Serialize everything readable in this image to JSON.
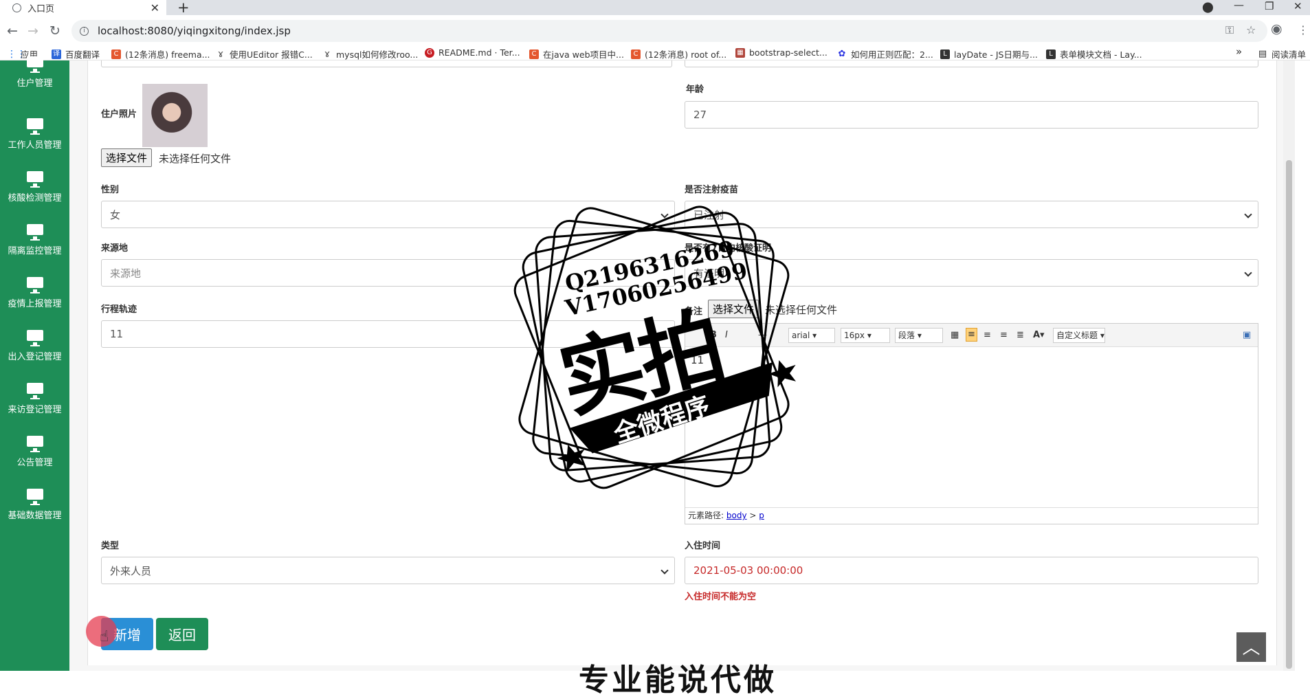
{
  "browser": {
    "tab_title": "入口页",
    "url": "localhost:8080/yiqingxitong/index.jsp",
    "bookmarks": [
      {
        "label": "应用",
        "color": "#1a73e8",
        "glyph": "⋮"
      },
      {
        "label": "百度翻译",
        "color": "#2b65d9",
        "glyph": "译"
      },
      {
        "label": "(12条消息) freema...",
        "color": "#e4572e",
        "glyph": "C"
      },
      {
        "label": "使用UEditor 报错C...",
        "color": "#555555",
        "glyph": "ɤ"
      },
      {
        "label": "mysql如何修改roo...",
        "color": "#555555",
        "glyph": "ɤ"
      },
      {
        "label": "README.md · Ter...",
        "color": "#c71d23",
        "glyph": "G"
      },
      {
        "label": "在java web项目中...",
        "color": "#e4572e",
        "glyph": "C"
      },
      {
        "label": "(12条消息) root of...",
        "color": "#e4572e",
        "glyph": "C"
      },
      {
        "label": "bootstrap-select...",
        "color": "#b0463c",
        "glyph": "▦"
      },
      {
        "label": "如何用正则匹配：2...",
        "color": "#2932e1",
        "glyph": "✿"
      },
      {
        "label": "layDate - JS日期与...",
        "color": "#333333",
        "glyph": "L"
      },
      {
        "label": "表单模块文档 - Lay...",
        "color": "#333333",
        "glyph": "L"
      }
    ],
    "more_glyph": "»",
    "reading_list": "阅读清单"
  },
  "sidebar": {
    "items": [
      {
        "label": "住户管理"
      },
      {
        "label": "工作人员管理"
      },
      {
        "label": "核酸检测管理"
      },
      {
        "label": "隔离监控管理"
      },
      {
        "label": "疫情上报管理"
      },
      {
        "label": "出入登记管理"
      },
      {
        "label": "来访登记管理"
      },
      {
        "label": "公告管理"
      },
      {
        "label": "基础数据管理"
      }
    ]
  },
  "form": {
    "photo_label": "住户照片",
    "file_button": "选择文件",
    "no_file": "未选择任何文件",
    "age_label": "年龄",
    "age_value": "27",
    "gender_label": "性别",
    "gender_value": "女",
    "vaccine_label": "是否注射疫苗",
    "vaccine_value": "已注射",
    "origin_label": "来源地",
    "origin_placeholder": "来源地",
    "proof_label": "是否有7日内核酸证明",
    "proof_value": "有证明",
    "track_label": "行程轨迹",
    "track_value": "11",
    "remark_label": "备注",
    "type_label": "类型",
    "type_value": "外来人员",
    "checkin_label": "入住时间",
    "checkin_value": "2021-05-03 00:00:00",
    "checkin_error": "入住时间不能为空",
    "add_button": "新增",
    "back_button": "返回"
  },
  "editor": {
    "font_family": "arial",
    "font_size": "16px",
    "paragraph": "段落",
    "custom_title": "自定义标题",
    "content": "11",
    "path_prefix": "元素路径:",
    "path_body": "body",
    "path_sep": ">",
    "path_p": "p"
  },
  "watermark": {
    "qq": "Q2196316269",
    "wechat": "V17060256499",
    "big_text": "实拍",
    "banner_text": "全微程序",
    "bottom_text": "专业能说代做"
  },
  "colors": {
    "sidebar": "#1e8e57",
    "primary_button": "#2a8fd6",
    "back_button": "#1e8e57",
    "error": "#c62828"
  }
}
